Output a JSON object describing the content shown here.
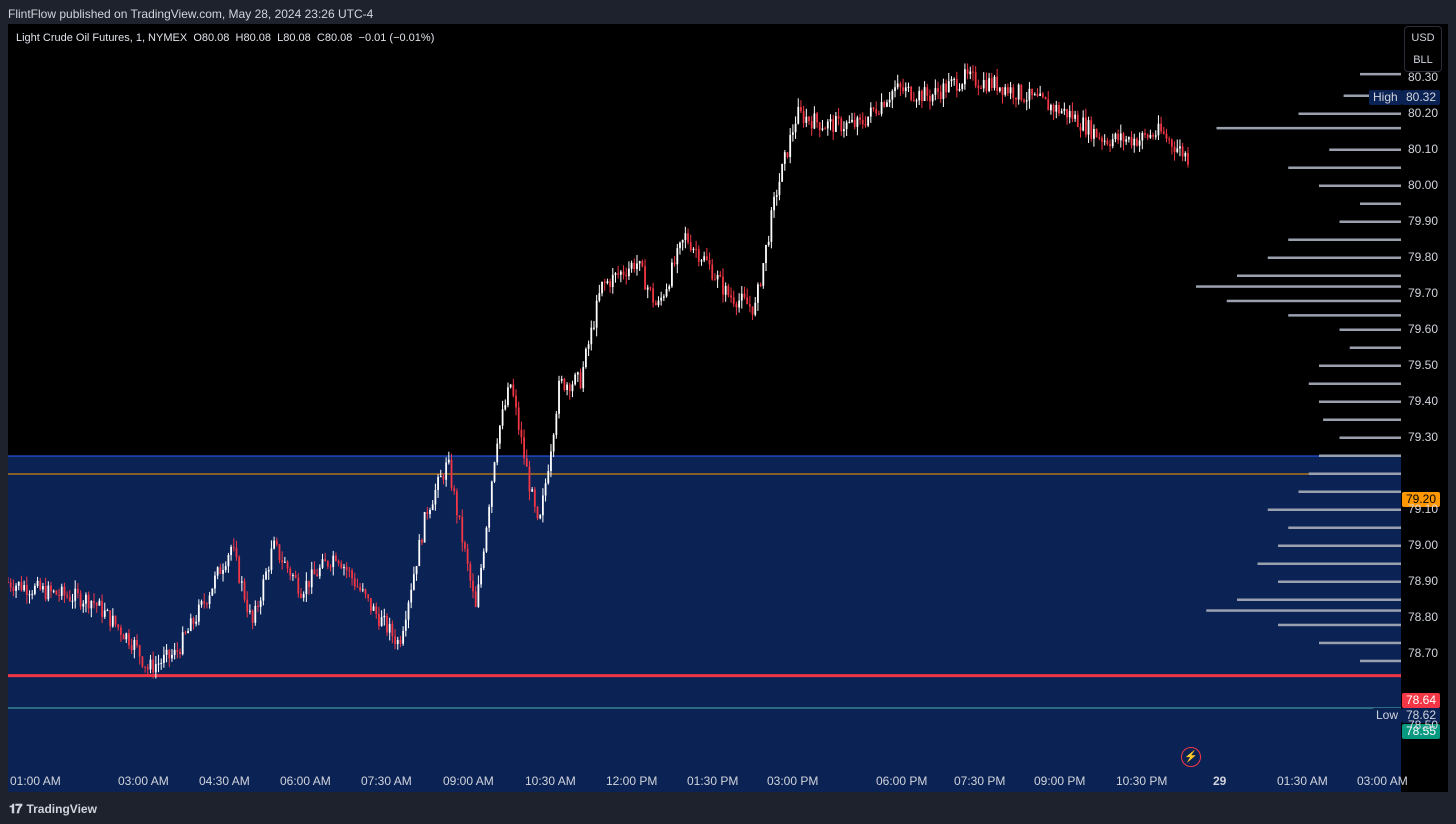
{
  "header": {
    "publisher_text": "FlintFlow published on TradingView.com, May 28, 2024 23:26 UTC-4"
  },
  "legend": {
    "symbol": "Light Crude Oil Futures, 1, NYMEX",
    "open": "O80.08",
    "high": "H80.08",
    "low": "L80.08",
    "close": "C80.08",
    "change": "−0.01 (−0.01%)"
  },
  "currency_box": {
    "currency": "USD",
    "unit": "BLL"
  },
  "price_tags": {
    "high_label": "High",
    "high_value": "80.32",
    "current_value": "79.20",
    "red_line_value": "78.64",
    "low_label": "Low",
    "low_value": "78.62",
    "green_value": "78.55"
  },
  "y_axis": {
    "labels": [
      "80.30",
      "80.20",
      "80.10",
      "80.00",
      "79.90",
      "79.80",
      "79.70",
      "79.60",
      "79.50",
      "79.40",
      "79.30",
      "79.10",
      "79.00",
      "78.90",
      "78.80",
      "78.70",
      "78.50"
    ]
  },
  "x_axis": {
    "labels": [
      "01:00 AM",
      "03:00 AM",
      "04:30 AM",
      "06:00 AM",
      "07:30 AM",
      "09:00 AM",
      "10:30 AM",
      "12:00 PM",
      "01:30 PM",
      "03:00 PM",
      "06:00 PM",
      "07:30 PM",
      "09:00 PM",
      "10:30 PM",
      "29",
      "01:30 AM",
      "03:00 AM"
    ]
  },
  "chart_data": {
    "type": "candlestick",
    "y_range": [
      78.45,
      80.35
    ],
    "zone": {
      "top": 79.25,
      "bottom": 78.45,
      "color": "#0b2354"
    },
    "lines": [
      {
        "value": 79.2,
        "color": "#ff9800"
      },
      {
        "value": 79.25,
        "color": "#2962ff"
      },
      {
        "value": 78.64,
        "color": "#f23645"
      },
      {
        "value": 78.55,
        "color": "#4db6ac"
      }
    ],
    "path": [
      {
        "t": 0,
        "p": 78.9
      },
      {
        "t": 0.03,
        "p": 78.87
      },
      {
        "t": 0.06,
        "p": 78.85
      },
      {
        "t": 0.09,
        "p": 78.73
      },
      {
        "t": 0.1,
        "p": 78.66
      },
      {
        "t": 0.12,
        "p": 78.7
      },
      {
        "t": 0.14,
        "p": 78.84
      },
      {
        "t": 0.16,
        "p": 79.0
      },
      {
        "t": 0.175,
        "p": 78.78
      },
      {
        "t": 0.19,
        "p": 79.0
      },
      {
        "t": 0.21,
        "p": 78.88
      },
      {
        "t": 0.235,
        "p": 78.98
      },
      {
        "t": 0.26,
        "p": 78.83
      },
      {
        "t": 0.28,
        "p": 78.73
      },
      {
        "t": 0.3,
        "p": 79.1
      },
      {
        "t": 0.315,
        "p": 79.23
      },
      {
        "t": 0.335,
        "p": 78.82
      },
      {
        "t": 0.35,
        "p": 79.3
      },
      {
        "t": 0.36,
        "p": 79.45
      },
      {
        "t": 0.37,
        "p": 79.24
      },
      {
        "t": 0.38,
        "p": 79.04
      },
      {
        "t": 0.395,
        "p": 79.45
      },
      {
        "t": 0.41,
        "p": 79.46
      },
      {
        "t": 0.425,
        "p": 79.72
      },
      {
        "t": 0.45,
        "p": 79.79
      },
      {
        "t": 0.465,
        "p": 79.66
      },
      {
        "t": 0.485,
        "p": 79.86
      },
      {
        "t": 0.5,
        "p": 79.79
      },
      {
        "t": 0.515,
        "p": 79.7
      },
      {
        "t": 0.535,
        "p": 79.66
      },
      {
        "t": 0.55,
        "p": 79.98
      },
      {
        "t": 0.565,
        "p": 80.2
      },
      {
        "t": 0.585,
        "p": 80.17
      },
      {
        "t": 0.61,
        "p": 80.17
      },
      {
        "t": 0.635,
        "p": 80.27
      },
      {
        "t": 0.66,
        "p": 80.25
      },
      {
        "t": 0.685,
        "p": 80.3
      },
      {
        "t": 0.71,
        "p": 80.28
      },
      {
        "t": 0.735,
        "p": 80.24
      },
      {
        "t": 0.76,
        "p": 80.2
      },
      {
        "t": 0.785,
        "p": 80.13
      },
      {
        "t": 0.81,
        "p": 80.13
      },
      {
        "t": 0.825,
        "p": 80.15
      },
      {
        "t": 0.845,
        "p": 80.08
      }
    ],
    "volume_profile_levels": [
      {
        "p": 80.31,
        "v": 0.2
      },
      {
        "p": 80.25,
        "v": 0.28
      },
      {
        "p": 80.2,
        "v": 0.5
      },
      {
        "p": 80.16,
        "v": 0.9
      },
      {
        "p": 80.1,
        "v": 0.35
      },
      {
        "p": 80.05,
        "v": 0.55
      },
      {
        "p": 80.0,
        "v": 0.4
      },
      {
        "p": 79.95,
        "v": 0.2
      },
      {
        "p": 79.9,
        "v": 0.3
      },
      {
        "p": 79.85,
        "v": 0.55
      },
      {
        "p": 79.8,
        "v": 0.65
      },
      {
        "p": 79.75,
        "v": 0.8
      },
      {
        "p": 79.72,
        "v": 1.0
      },
      {
        "p": 79.68,
        "v": 0.85
      },
      {
        "p": 79.64,
        "v": 0.55
      },
      {
        "p": 79.6,
        "v": 0.3
      },
      {
        "p": 79.55,
        "v": 0.25
      },
      {
        "p": 79.5,
        "v": 0.4
      },
      {
        "p": 79.45,
        "v": 0.45
      },
      {
        "p": 79.4,
        "v": 0.4
      },
      {
        "p": 79.35,
        "v": 0.38
      },
      {
        "p": 79.3,
        "v": 0.3
      },
      {
        "p": 79.25,
        "v": 0.4
      },
      {
        "p": 79.2,
        "v": 0.45
      },
      {
        "p": 79.15,
        "v": 0.5
      },
      {
        "p": 79.1,
        "v": 0.65
      },
      {
        "p": 79.05,
        "v": 0.55
      },
      {
        "p": 79.0,
        "v": 0.6
      },
      {
        "p": 78.95,
        "v": 0.7
      },
      {
        "p": 78.9,
        "v": 0.6
      },
      {
        "p": 78.85,
        "v": 0.8
      },
      {
        "p": 78.82,
        "v": 0.95
      },
      {
        "p": 78.78,
        "v": 0.6
      },
      {
        "p": 78.73,
        "v": 0.4
      },
      {
        "p": 78.68,
        "v": 0.2
      }
    ]
  }
}
